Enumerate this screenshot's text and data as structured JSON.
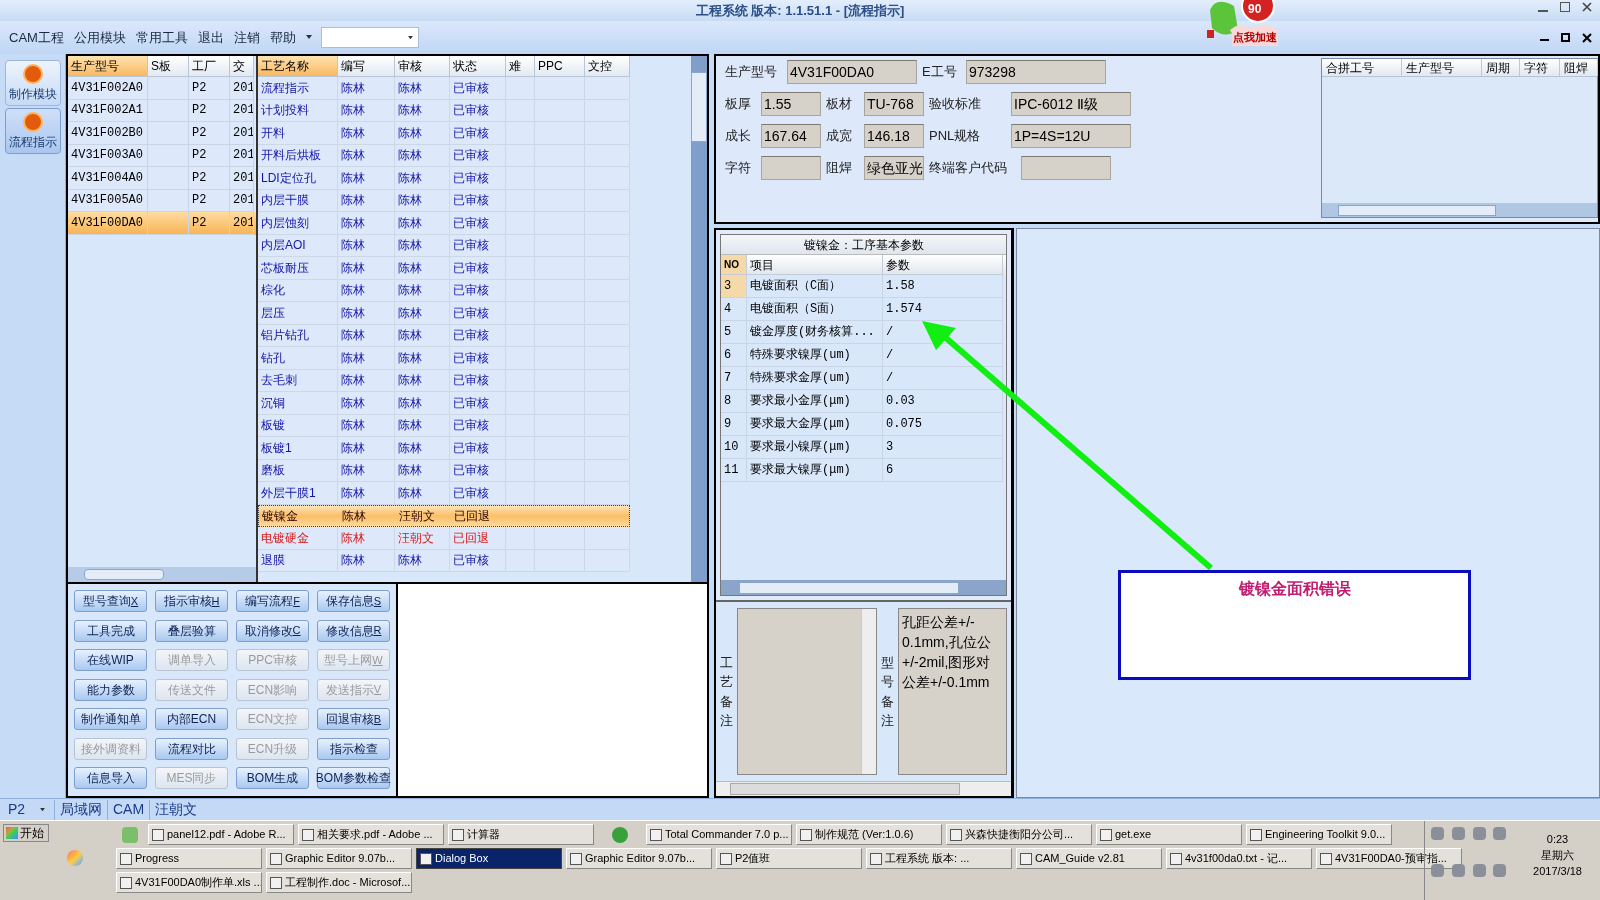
{
  "window": {
    "title": "工程系统  版本: 1.1.51.1 - [流程指示]"
  },
  "speed_badge": {
    "value": "90",
    "label": "点我加速"
  },
  "menu": {
    "items": [
      "CAM工程",
      "公用模块",
      "常用工具",
      "退出",
      "注销",
      "帮助"
    ]
  },
  "sidebar": {
    "items": [
      {
        "label": "制作模块",
        "selected": false
      },
      {
        "label": "流程指示",
        "selected": true
      }
    ]
  },
  "model_grid": {
    "columns": [
      "生产型号",
      "S板",
      "工厂",
      "交"
    ],
    "rows": [
      {
        "model": "4V31F002A0",
        "factory": "P2",
        "column_4": "201",
        "selected": false
      },
      {
        "model": "4V31F002A1",
        "factory": "P2",
        "column_4": "201",
        "selected": false
      },
      {
        "model": "4V31F002B0",
        "factory": "P2",
        "column_4": "201",
        "selected": false
      },
      {
        "model": "4V31F003A0",
        "factory": "P2",
        "column_4": "201",
        "selected": false
      },
      {
        "model": "4V31F004A0",
        "factory": "P2",
        "column_4": "201",
        "selected": false
      },
      {
        "model": "4V31F005A0",
        "factory": "P2",
        "column_4": "201",
        "selected": false
      },
      {
        "model": "4V31F00DA0",
        "factory": "P2",
        "column_4": "201",
        "selected": true
      }
    ]
  },
  "process_grid": {
    "columns": [
      "工艺名称",
      "编写",
      "审核",
      "状态",
      "难",
      "PPC",
      "文控"
    ],
    "rows": [
      {
        "cells": [
          "流程指示",
          "陈林",
          "陈林",
          "已审核"
        ],
        "selected": false,
        "returned": false
      },
      {
        "cells": [
          "计划投料",
          "陈林",
          "陈林",
          "已审核"
        ],
        "selected": false,
        "returned": false
      },
      {
        "cells": [
          "开料",
          "陈林",
          "陈林",
          "已审核"
        ],
        "selected": false,
        "returned": false
      },
      {
        "cells": [
          "开料后烘板",
          "陈林",
          "陈林",
          "已审核"
        ],
        "selected": false,
        "returned": false
      },
      {
        "cells": [
          "LDI定位孔",
          "陈林",
          "陈林",
          "已审核"
        ],
        "selected": false,
        "returned": false
      },
      {
        "cells": [
          "内层干膜",
          "陈林",
          "陈林",
          "已审核"
        ],
        "selected": false,
        "returned": false
      },
      {
        "cells": [
          "内层蚀刻",
          "陈林",
          "陈林",
          "已审核"
        ],
        "selected": false,
        "returned": false
      },
      {
        "cells": [
          "内层AOI",
          "陈林",
          "陈林",
          "已审核"
        ],
        "selected": false,
        "returned": false
      },
      {
        "cells": [
          "芯板耐压",
          "陈林",
          "陈林",
          "已审核"
        ],
        "selected": false,
        "returned": false
      },
      {
        "cells": [
          "棕化",
          "陈林",
          "陈林",
          "已审核"
        ],
        "selected": false,
        "returned": false
      },
      {
        "cells": [
          "层压",
          "陈林",
          "陈林",
          "已审核"
        ],
        "selected": false,
        "returned": false
      },
      {
        "cells": [
          "铝片钻孔",
          "陈林",
          "陈林",
          "已审核"
        ],
        "selected": false,
        "returned": false
      },
      {
        "cells": [
          "钻孔",
          "陈林",
          "陈林",
          "已审核"
        ],
        "selected": false,
        "returned": false
      },
      {
        "cells": [
          "去毛刺",
          "陈林",
          "陈林",
          "已审核"
        ],
        "selected": false,
        "returned": false
      },
      {
        "cells": [
          "沉铜",
          "陈林",
          "陈林",
          "已审核"
        ],
        "selected": false,
        "returned": false
      },
      {
        "cells": [
          "板镀",
          "陈林",
          "陈林",
          "已审核"
        ],
        "selected": false,
        "returned": false
      },
      {
        "cells": [
          "板镀1",
          "陈林",
          "陈林",
          "已审核"
        ],
        "selected": false,
        "returned": false
      },
      {
        "cells": [
          "磨板",
          "陈林",
          "陈林",
          "已审核"
        ],
        "selected": false,
        "returned": false
      },
      {
        "cells": [
          "外层干膜1",
          "陈林",
          "陈林",
          "已审核"
        ],
        "selected": false,
        "returned": false
      },
      {
        "cells": [
          "镀镍金",
          "陈林",
          "汪朝文",
          "已回退"
        ],
        "selected": true,
        "returned": true
      },
      {
        "cells": [
          "电镀硬金",
          "陈林",
          "汪朝文",
          "已回退"
        ],
        "selected": false,
        "returned": true
      },
      {
        "cells": [
          "退膜",
          "陈林",
          "陈林",
          "已审核"
        ],
        "selected": false,
        "returned": false
      }
    ]
  },
  "buttons": [
    {
      "label": "型号查询",
      "key": "X",
      "disabled": false
    },
    {
      "label": "指示审核",
      "key": "H",
      "disabled": false
    },
    {
      "label": "编写流程",
      "key": "F",
      "disabled": false
    },
    {
      "label": "保存信息",
      "key": "S",
      "disabled": false
    },
    {
      "label": "工具完成",
      "disabled": false
    },
    {
      "label": "叠层验算",
      "disabled": false
    },
    {
      "label": "取消修改",
      "key": "C",
      "disabled": false
    },
    {
      "label": "修改信息",
      "key": "R",
      "disabled": false
    },
    {
      "label": "在线WIP",
      "disabled": false
    },
    {
      "label": "调单导入",
      "disabled": true
    },
    {
      "label": "PPC审核",
      "disabled": true
    },
    {
      "label": "型号上网",
      "key": "W",
      "disabled": true
    },
    {
      "label": "能力参数",
      "disabled": false
    },
    {
      "label": "传送文件",
      "disabled": true
    },
    {
      "label": "ECN影响",
      "disabled": true
    },
    {
      "label": "发送指示",
      "key": "V",
      "disabled": true
    },
    {
      "label": "制作通知单",
      "disabled": false
    },
    {
      "label": "内部ECN",
      "disabled": false
    },
    {
      "label": "ECN文控",
      "disabled": true
    },
    {
      "label": "回退审核",
      "key": "B",
      "disabled": false
    },
    {
      "label": "接外调资料",
      "disabled": true
    },
    {
      "label": "流程对比",
      "disabled": false
    },
    {
      "label": "ECN升级",
      "disabled": true
    },
    {
      "label": "指示检查",
      "disabled": false
    },
    {
      "label": "信息导入",
      "disabled": false
    },
    {
      "label": "MES同步",
      "disabled": true
    },
    {
      "label": "BOM生成",
      "disabled": false
    },
    {
      "label": "BOM参数检查",
      "disabled": false
    }
  ],
  "info": {
    "fields": [
      {
        "label": "生产型号",
        "value": "4V31F00DA0"
      },
      {
        "label": "E工号",
        "value": "973298"
      },
      {
        "label": "板厚",
        "value": "1.55"
      },
      {
        "label": "板材",
        "value": "TU-768"
      },
      {
        "label": "验收标准",
        "value": "IPC-6012 Ⅱ级"
      },
      {
        "label": "成长",
        "value": "167.64"
      },
      {
        "label": "成宽",
        "value": "146.18"
      },
      {
        "label": "PNL规格",
        "value": "1P=4S=12U"
      },
      {
        "label": "字符"
      },
      {
        "label": "阻焊",
        "value": "绿色亚光"
      },
      {
        "label": "终端客户代码"
      }
    ]
  },
  "merge_table": {
    "columns": [
      "合拼工号",
      "生产型号",
      "周期",
      "字符",
      "阻焊"
    ]
  },
  "params": {
    "title": "镀镍金：工序基本参数",
    "columns": [
      "NO",
      "项目",
      "参数"
    ],
    "rows": [
      {
        "no": "3",
        "item": "电镀面积（C面）",
        "value": "1.58",
        "selected": true
      },
      {
        "no": "4",
        "item": "电镀面积（S面）",
        "value": "1.574",
        "selected": false
      },
      {
        "no": "5",
        "item": "镀金厚度(财务核算...",
        "value": "/",
        "selected": false
      },
      {
        "no": "6",
        "item": "特殊要求镍厚(um)",
        "value": "/",
        "selected": false
      },
      {
        "no": "7",
        "item": "特殊要求金厚(um)",
        "value": "/",
        "selected": false
      },
      {
        "no": "8",
        "item": "要求最小金厚(μm)",
        "value": "0.03",
        "selected": false
      },
      {
        "no": "9",
        "item": "要求最大金厚(μm)",
        "value": "0.075",
        "selected": false
      },
      {
        "no": "10",
        "item": "要求最小镍厚(μm)",
        "value": "3",
        "selected": false
      },
      {
        "no": "11",
        "item": "要求最大镍厚(μm)",
        "value": "6",
        "selected": false
      }
    ]
  },
  "notes": {
    "process_label": "工艺备注",
    "model_label": "型号备注",
    "model_lines": [
      "孔距公差+/-",
      "0.1mm,孔位公",
      "+/-2mil,图形对",
      "公差+/-0.1mm"
    ]
  },
  "annotation": {
    "text": "镀镍金面积错误"
  },
  "status_bar": {
    "factory": "P2",
    "items": [
      "局域网",
      "CAM",
      "汪朝文"
    ]
  },
  "taskbar": {
    "start": "开始",
    "buttons": [
      {
        "label": "panel12.pdf - Adobe R...",
        "selected": false
      },
      {
        "label": "相关要求.pdf - Adobe ...",
        "selected": false
      },
      {
        "label": "计算器",
        "selected": false
      },
      {
        "label": "Total Commander 7.0 p...",
        "selected": false
      },
      {
        "label": "制作规范 (Ver:1.0.6)",
        "selected": false
      },
      {
        "label": "兴森快捷衡阳分公司...",
        "selected": false
      },
      {
        "label": "get.exe",
        "selected": false
      },
      {
        "label": "Engineering Toolkit 9.0...",
        "selected": false
      },
      {
        "label": "Progress",
        "selected": false
      },
      {
        "label": "Graphic Editor 9.07b...",
        "selected": false
      },
      {
        "label": "Dialog Box",
        "selected": true
      },
      {
        "label": "Graphic Editor 9.07b...",
        "selected": false
      },
      {
        "label": "P2值班",
        "selected": false
      },
      {
        "label": "工程系统  版本: ...",
        "selected": false
      },
      {
        "label": "CAM_Guide v2.81",
        "selected": false
      },
      {
        "label": "4v31f00da0.txt - 记...",
        "selected": false
      },
      {
        "label": "4V31F00DA0-预审指...",
        "selected": false
      },
      {
        "label": "4V31F00DA0制作单.xls ...",
        "selected": false
      },
      {
        "label": "工程制作.doc - Microsof...",
        "selected": false
      }
    ],
    "clock": {
      "time": "0:23",
      "day": "星期六",
      "date": "2017/3/18"
    }
  }
}
